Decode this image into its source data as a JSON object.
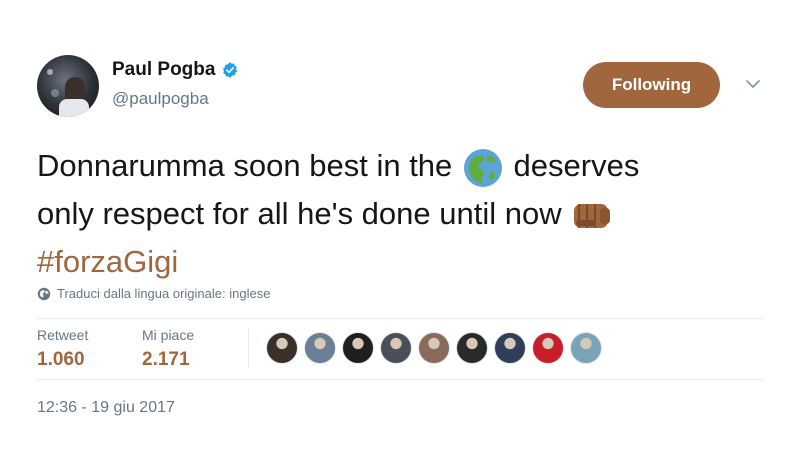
{
  "user": {
    "name": "Paul Pogba",
    "handle": "@paulpogba",
    "verified": true
  },
  "follow_button": {
    "label": "Following"
  },
  "tweet": {
    "line1_before": "Donnarumma soon best in the",
    "line1_after": "deserves",
    "line2": "only respect for all he's done until now",
    "hashtag": "#forzaGigi",
    "emojis": [
      "globe-americas-emoji",
      "oncoming-fist-emoji"
    ]
  },
  "translate": {
    "label": "Traduci dalla lingua originale: inglese"
  },
  "stats": {
    "retweet_label": "Retweet",
    "retweet_value": "1.060",
    "likes_label": "Mi piace",
    "likes_value": "2.171"
  },
  "likers": [
    {
      "color": "#3b2f2a"
    },
    {
      "color": "#6b7f99"
    },
    {
      "color": "#1f1f1f"
    },
    {
      "color": "#4a4f5a"
    },
    {
      "color": "#8a6a5a"
    },
    {
      "color": "#2a2a2a"
    },
    {
      "color": "#2f3f5a"
    },
    {
      "color": "#c81e2a"
    },
    {
      "color": "#7aa3b8"
    }
  ],
  "timestamp": "12:36 - 19 giu 2017",
  "colors": {
    "accent": "#a0663e",
    "secondary_text": "#657786",
    "verified_blue": "#1da1f2"
  }
}
